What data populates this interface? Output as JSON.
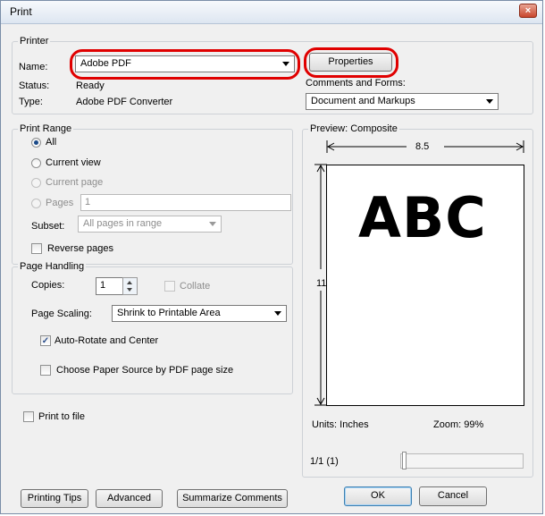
{
  "window": {
    "title": "Print",
    "close_glyph": "×"
  },
  "printer": {
    "group_label": "Printer",
    "name_label": "Name:",
    "name_value": "Adobe PDF",
    "status_label": "Status:",
    "status_value": "Ready",
    "type_label": "Type:",
    "type_value": "Adobe PDF Converter",
    "properties_button": "Properties",
    "comments_label": "Comments and Forms:",
    "comments_value": "Document and Markups"
  },
  "print_range": {
    "group_label": "Print Range",
    "all": "All",
    "current_view": "Current view",
    "current_page": "Current page",
    "pages": "Pages",
    "pages_value": "1",
    "subset_label": "Subset:",
    "subset_value": "All pages in range",
    "reverse_pages": "Reverse pages"
  },
  "page_handling": {
    "group_label": "Page Handling",
    "copies_label": "Copies:",
    "copies_value": "1",
    "collate": "Collate",
    "scaling_label": "Page Scaling:",
    "scaling_value": "Shrink to Printable Area",
    "auto_rotate": "Auto-Rotate and Center",
    "auto_rotate_checked": true,
    "paper_source": "Choose Paper Source by PDF page size"
  },
  "print_to_file": "Print to file",
  "preview": {
    "label": "Preview: Composite",
    "width_value": "8.5",
    "height_value": "11",
    "sample_text": "ABC",
    "units": "Units: Inches",
    "zoom": "Zoom:  99%",
    "page_indicator": "1/1 (1)"
  },
  "buttons": {
    "printing_tips": "Printing Tips",
    "advanced": "Advanced",
    "summarize_comments": "Summarize Comments",
    "ok": "OK",
    "cancel": "Cancel"
  },
  "colors": {
    "highlight": "#e00000",
    "title_bar": "#dde6f1"
  },
  "icons": {
    "checkmark": "✓"
  }
}
